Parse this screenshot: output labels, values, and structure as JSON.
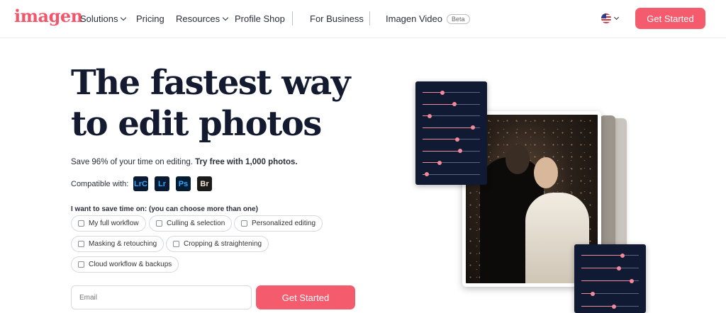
{
  "brand": {
    "name": "imagen",
    "accent": "#f45b6c"
  },
  "nav": {
    "items": [
      {
        "label": "Solutions",
        "dropdown": true
      },
      {
        "label": "Pricing",
        "dropdown": false
      },
      {
        "label": "Resources",
        "dropdown": true
      },
      {
        "label": "Profile Shop",
        "dropdown": false
      },
      {
        "label": "For Business",
        "dropdown": false
      },
      {
        "label": "Imagen Video",
        "dropdown": false,
        "badge": "Beta"
      }
    ],
    "locale_icon": "us-flag-icon",
    "cta_label": "Get Started"
  },
  "hero": {
    "headline_line1": "The fastest way",
    "headline_line2": "to edit photos",
    "sub_plain": "Save 96% of your time on editing.",
    "sub_bold": "Try free with 1,000 photos.",
    "compatible_label": "Compatible with:",
    "apps": [
      "LrC",
      "Lr",
      "Ps",
      "Br"
    ],
    "question": "I want to save time on: (you can choose more than one)",
    "options": [
      "My full workflow",
      "Culling & selection",
      "Personalized editing",
      "Masking & retouching",
      "Cropping & straightening",
      "Cloud workflow & backups"
    ],
    "email_placeholder": "Email",
    "cta_label": "Get Started"
  },
  "visual": {
    "top_panel_slider_levels": [
      0.35,
      0.55,
      0.12,
      0.88,
      0.6,
      0.66,
      0.3,
      0.08
    ],
    "bottom_panel_slider_levels": [
      0.72,
      0.66,
      0.88,
      0.2,
      0.57
    ]
  }
}
